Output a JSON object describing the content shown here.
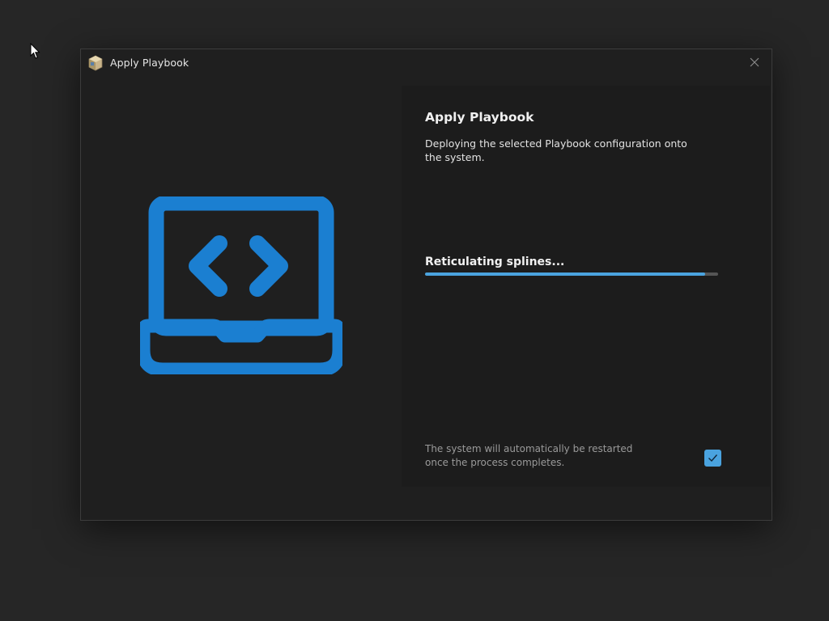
{
  "window": {
    "title": "Apply Playbook",
    "close_icon": "close-icon"
  },
  "main": {
    "heading": "Apply Playbook",
    "description": "Deploying the selected Playbook configuration onto the system.",
    "status": "Reticulating splines...",
    "progress": 0.955,
    "restart_note_line1": "The system will automatically be restarted",
    "restart_note_line2": "once the process completes.",
    "restart_checked": true
  },
  "icons": {
    "hero": "laptop-code-icon",
    "app": "app-box-icon",
    "cursor": "mouse-cursor-icon"
  },
  "colors": {
    "accent": "#4aa3df",
    "hero_icon": "#1b7fd1",
    "window_bg": "#1f1f1f",
    "desktop_bg": "#262626"
  }
}
